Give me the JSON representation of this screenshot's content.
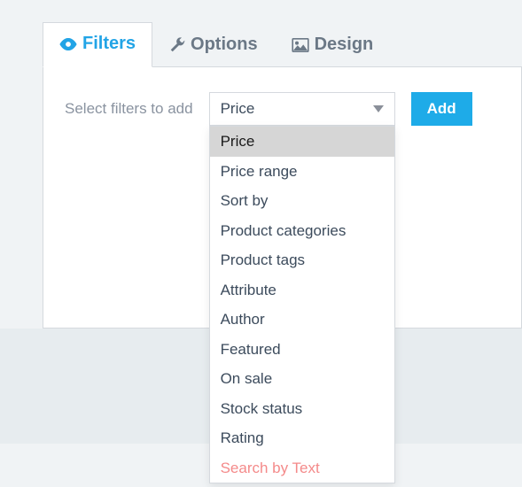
{
  "tabs": [
    {
      "label": "Filters",
      "icon": "eye-icon",
      "active": true
    },
    {
      "label": "Options",
      "icon": "wrench-icon",
      "active": false
    },
    {
      "label": "Design",
      "icon": "image-icon",
      "active": false
    }
  ],
  "filters_panel": {
    "select_label": "Select filters to add",
    "selected_value": "Price",
    "add_button": "Add",
    "options": [
      {
        "label": "Price",
        "highlighted": true
      },
      {
        "label": "Price range"
      },
      {
        "label": "Sort by"
      },
      {
        "label": "Product categories"
      },
      {
        "label": "Product tags"
      },
      {
        "label": "Attribute"
      },
      {
        "label": "Author"
      },
      {
        "label": "Featured"
      },
      {
        "label": "On sale"
      },
      {
        "label": "Stock status"
      },
      {
        "label": "Rating"
      },
      {
        "label": "Search by Text",
        "special": true
      }
    ]
  },
  "colors": {
    "accent": "#22a4e6",
    "button": "#1eabe8",
    "muted_text": "#8a93a0",
    "special_option": "#f48a8a"
  }
}
